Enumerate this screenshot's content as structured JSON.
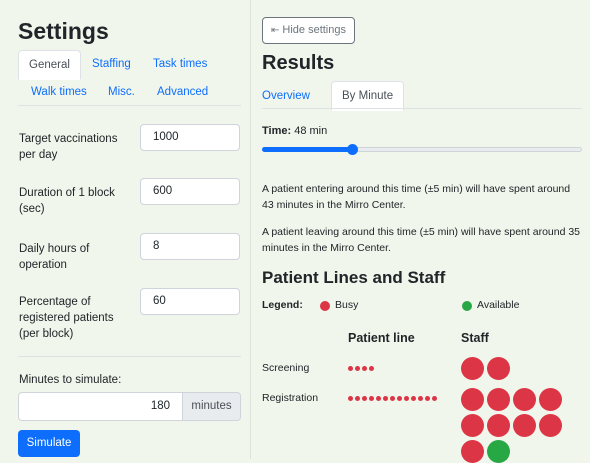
{
  "settings": {
    "title": "Settings",
    "tabs": [
      "General",
      "Staffing",
      "Task times",
      "Walk times",
      "Misc.",
      "Advanced"
    ],
    "fields": [
      {
        "label": "Target vaccinations per day",
        "value": "1000"
      },
      {
        "label": "Duration of 1 block (sec)",
        "value": "600"
      },
      {
        "label": "Daily hours of operation",
        "value": "8"
      },
      {
        "label": "Percentage of registered patients (per block)",
        "value": "60"
      }
    ],
    "minutes_label": "Minutes to simulate:",
    "minutes_value": "180",
    "minutes_unit": "minutes",
    "simulate_label": "Simulate"
  },
  "results": {
    "hide_button": "Hide settings",
    "hide_icon": "arrow-left-bar-icon",
    "title": "Results",
    "tabs": [
      "Overview",
      "By Minute"
    ],
    "time_label": "Time:",
    "time_value": "48 min",
    "slider_fraction": 0.28,
    "entering_text": "A patient entering around this time (±5 min) will have spent around 43 minutes in the Mirro Center.",
    "leaving_text": "A patient leaving around this time (±5 min) will have spent around 35 minutes in the Mirro Center.",
    "lines_title": "Patient Lines and Staff",
    "legend_label": "Legend:",
    "legend_busy": "Busy",
    "legend_available": "Available",
    "col_patient_line": "Patient line",
    "col_staff": "Staff",
    "colors": {
      "busy": "#dc3545",
      "available": "#28a745",
      "accent": "#0d6efd"
    },
    "rows": [
      {
        "name": "Screening",
        "line_count": 4,
        "staff_busy": 2,
        "staff_available": 0
      },
      {
        "name": "Registration",
        "line_count": 13,
        "staff_busy": 9,
        "staff_available": 1
      }
    ]
  }
}
